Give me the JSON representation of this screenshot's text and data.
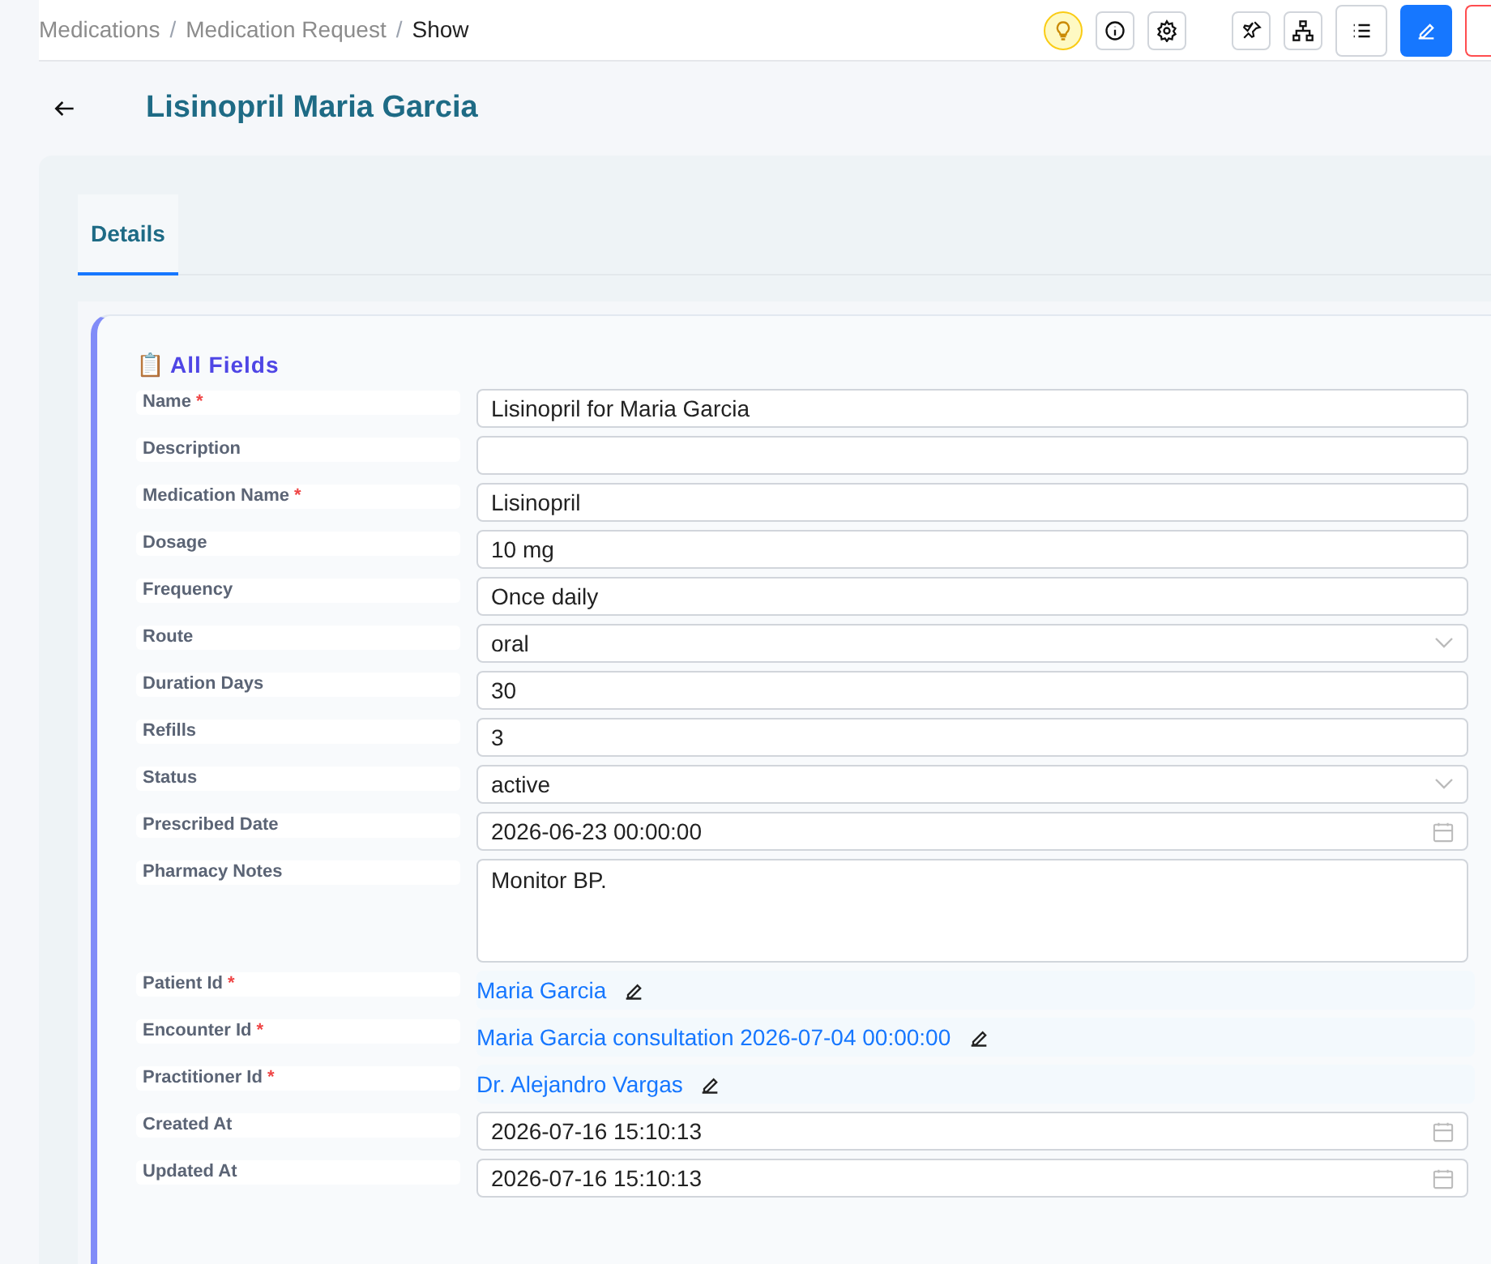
{
  "breadcrumb": [
    {
      "label": "Medications",
      "current": false
    },
    {
      "separator": "/"
    },
    {
      "label": "Medication Request",
      "current": false
    },
    {
      "separator": "/"
    },
    {
      "label": "Show",
      "current": true
    }
  ],
  "title": "Lisinopril Maria Garcia",
  "tabs": [
    {
      "label": "Details",
      "selected": true
    }
  ],
  "section": {
    "icon": "📋",
    "title": "All Fields"
  },
  "fields": [
    {
      "label": "Name",
      "required_mark": "*",
      "kind": "text",
      "value": "Lisinopril for Maria Garcia"
    },
    {
      "label": "Description",
      "kind": "text"
    },
    {
      "label": "Medication Name",
      "required_mark": "*",
      "kind": "text",
      "value": "Lisinopril"
    },
    {
      "label": "Dosage",
      "kind": "text",
      "value": "10 mg"
    },
    {
      "label": "Frequency",
      "kind": "text",
      "value": "Once daily"
    },
    {
      "label": "Route",
      "kind": "select",
      "value": "oral"
    },
    {
      "label": "Duration Days",
      "kind": "text",
      "value": "30"
    },
    {
      "label": "Refills",
      "kind": "text",
      "value": "3"
    },
    {
      "label": "Status",
      "kind": "select",
      "value": "active"
    },
    {
      "label": "Prescribed Date",
      "kind": "date",
      "value": "2026-06-23 00:00:00"
    },
    {
      "label": "Pharmacy Notes",
      "kind": "textarea",
      "value": "Monitor BP."
    },
    {
      "label": "Patient Id",
      "required_mark": "*",
      "kind": "link",
      "value": "Maria Garcia"
    },
    {
      "label": "Encounter Id",
      "required_mark": "*",
      "kind": "link",
      "value": "Maria Garcia consultation 2026-07-04 00:00:00"
    },
    {
      "label": "Practitioner Id",
      "required_mark": "*",
      "kind": "link",
      "value": "Dr. Alejandro Vargas"
    },
    {
      "label": "Created At",
      "kind": "date",
      "value": "2026-07-16 15:10:13"
    },
    {
      "label": "Updated At",
      "kind": "date",
      "value": "2026-07-16 15:10:13"
    }
  ]
}
